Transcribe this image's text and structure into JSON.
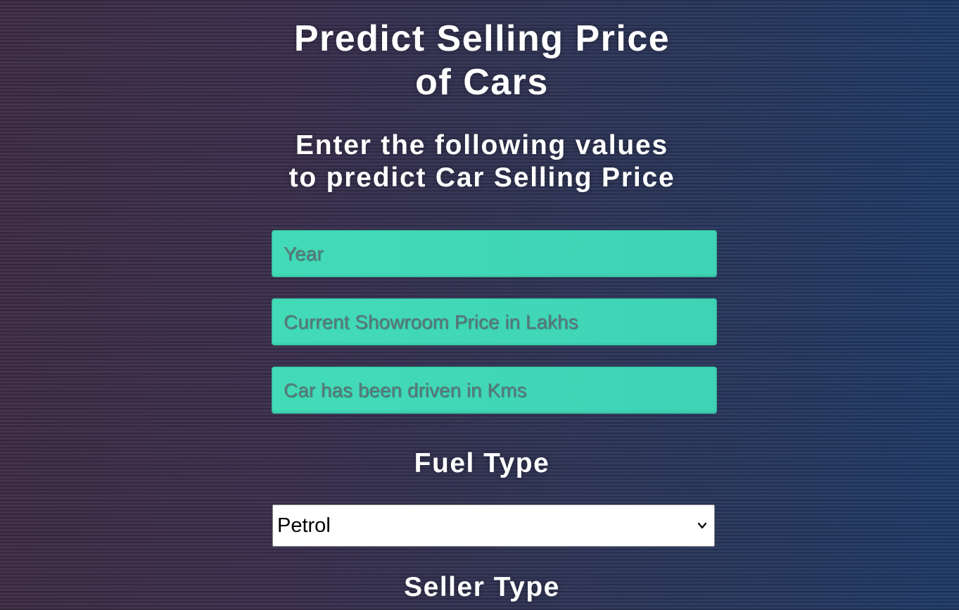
{
  "page": {
    "title_line1": "Predict Selling Price",
    "title_line2": "of Cars",
    "subtitle_line1": "Enter the following values",
    "subtitle_line2": "to predict Car Selling Price"
  },
  "form": {
    "year": {
      "placeholder": "Year",
      "value": ""
    },
    "present_price": {
      "placeholder": "Current Showroom Price in Lakhs",
      "value": ""
    },
    "kms_driven": {
      "placeholder": "Car has been driven in Kms",
      "value": ""
    },
    "fuel_type": {
      "label": "Fuel Type",
      "selected": "Petrol",
      "icon": "chevron-down-icon"
    },
    "seller_type": {
      "label": "Seller Type"
    }
  },
  "colors": {
    "input_bg": "#42dbb8",
    "placeholder_text": "#5f757a",
    "heading_text": "#ffffff"
  }
}
